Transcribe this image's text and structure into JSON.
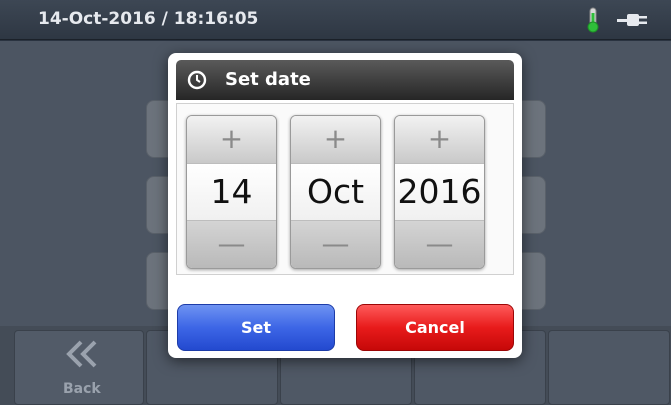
{
  "status_bar": {
    "datetime": "14-Oct-2016 / 18:16:05",
    "icons": [
      "thermometer-icon",
      "power-plug-icon"
    ]
  },
  "back": {
    "label": "Back",
    "icon": "double-chevron-left-icon"
  },
  "dialog": {
    "title": "Set date",
    "icon": "clock-icon",
    "spinners": {
      "day": {
        "value": "14",
        "increment": "+",
        "decrement": "—"
      },
      "month": {
        "value": "Oct",
        "increment": "+",
        "decrement": "—"
      },
      "year": {
        "value": "2016",
        "increment": "+",
        "decrement": "—"
      }
    },
    "set_label": "Set",
    "cancel_label": "Cancel"
  },
  "colors": {
    "set_button": "#3d66e6",
    "cancel_button": "#e81b1b",
    "header": "#262626",
    "thermometer": "#2fbf3a"
  }
}
